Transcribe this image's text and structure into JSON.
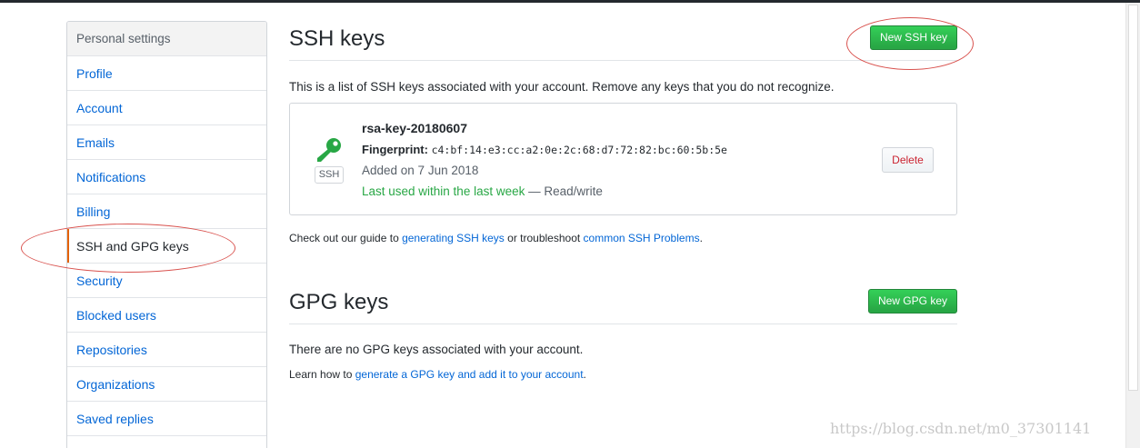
{
  "sidebar": {
    "header": "Personal settings",
    "items": [
      {
        "label": "Profile"
      },
      {
        "label": "Account"
      },
      {
        "label": "Emails"
      },
      {
        "label": "Notifications"
      },
      {
        "label": "Billing"
      },
      {
        "label": "SSH and GPG keys",
        "selected": true
      },
      {
        "label": "Security"
      },
      {
        "label": "Blocked users"
      },
      {
        "label": "Repositories"
      },
      {
        "label": "Organizations"
      },
      {
        "label": "Saved replies"
      }
    ]
  },
  "ssh": {
    "title": "SSH keys",
    "new_button": "New SSH key",
    "intro": "This is a list of SSH keys associated with your account. Remove any keys that you do not recognize.",
    "key": {
      "icon": "key-icon",
      "badge": "SSH",
      "name": "rsa-key-20180607",
      "fingerprint_label": "Fingerprint:",
      "fingerprint": "c4:bf:14:e3:cc:a2:0e:2c:68:d7:72:82:bc:60:5b:5e",
      "added": "Added on 7 Jun 2018",
      "last_used": "Last used within the last week",
      "access": " — Read/write",
      "delete_button": "Delete"
    },
    "guide": {
      "prefix": "Check out our guide to ",
      "link1": "generating SSH keys",
      "middle": " or troubleshoot ",
      "link2": "common SSH Problems",
      "suffix": "."
    }
  },
  "gpg": {
    "title": "GPG keys",
    "new_button": "New GPG key",
    "empty": "There are no GPG keys associated with your account.",
    "learn_prefix": "Learn how to ",
    "learn_link": "generate a GPG key and add it to your account",
    "learn_suffix": "."
  },
  "watermark": "https://blog.csdn.net/m0_37301141",
  "colors": {
    "link": "#0366d6",
    "green": "#28a745",
    "danger": "#cb2431",
    "selected_bar": "#e36209",
    "annotation": "#d9534f"
  }
}
